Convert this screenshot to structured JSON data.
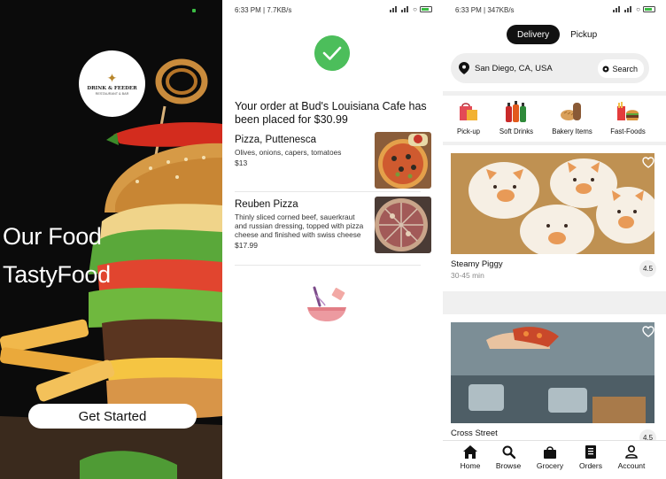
{
  "splash": {
    "logo_name": "DRINK & FEEDER",
    "logo_sub": "RESTAURANT & BAR",
    "headline_1": "Our Food",
    "headline_2": "TastyFood",
    "cta_label": "Get Started"
  },
  "order_screen": {
    "status_time": "6:33 PM | 7.7KB/s",
    "message": "Your order at Bud's Louisiana Cafe has been placed for $30.99",
    "items": [
      {
        "name": "Pizza, Puttenesca",
        "description": "Olives, onions, capers, tomatoes",
        "price": "$13"
      },
      {
        "name": "Reuben Pizza",
        "description": "Thinly sliced corned beef, sauerkraut and russian dressing, topped with pizza cheese and finished with swiss cheese",
        "price": "$17.99"
      }
    ]
  },
  "home_screen": {
    "status_time": "6:33 PM | 347KB/s",
    "mode_tabs": [
      "Delivery",
      "Pickup"
    ],
    "location": "San Diego, CA, USA",
    "search_label": "Search",
    "categories": [
      "Pick-up",
      "Soft Drinks",
      "Bakery Items",
      "Fast-Foods"
    ],
    "restaurants": [
      {
        "name": "Steamy Piggy",
        "eta": "30-45 min",
        "rating": "4.5"
      },
      {
        "name": "Cross Street",
        "eta": "",
        "rating": "4.5"
      }
    ],
    "bottom_nav": [
      "Home",
      "Browse",
      "Grocery",
      "Orders",
      "Account"
    ]
  },
  "colors": {
    "success_green": "#4cbe5b",
    "active_tab": "#111111",
    "accent_red": "#d94a3b"
  }
}
